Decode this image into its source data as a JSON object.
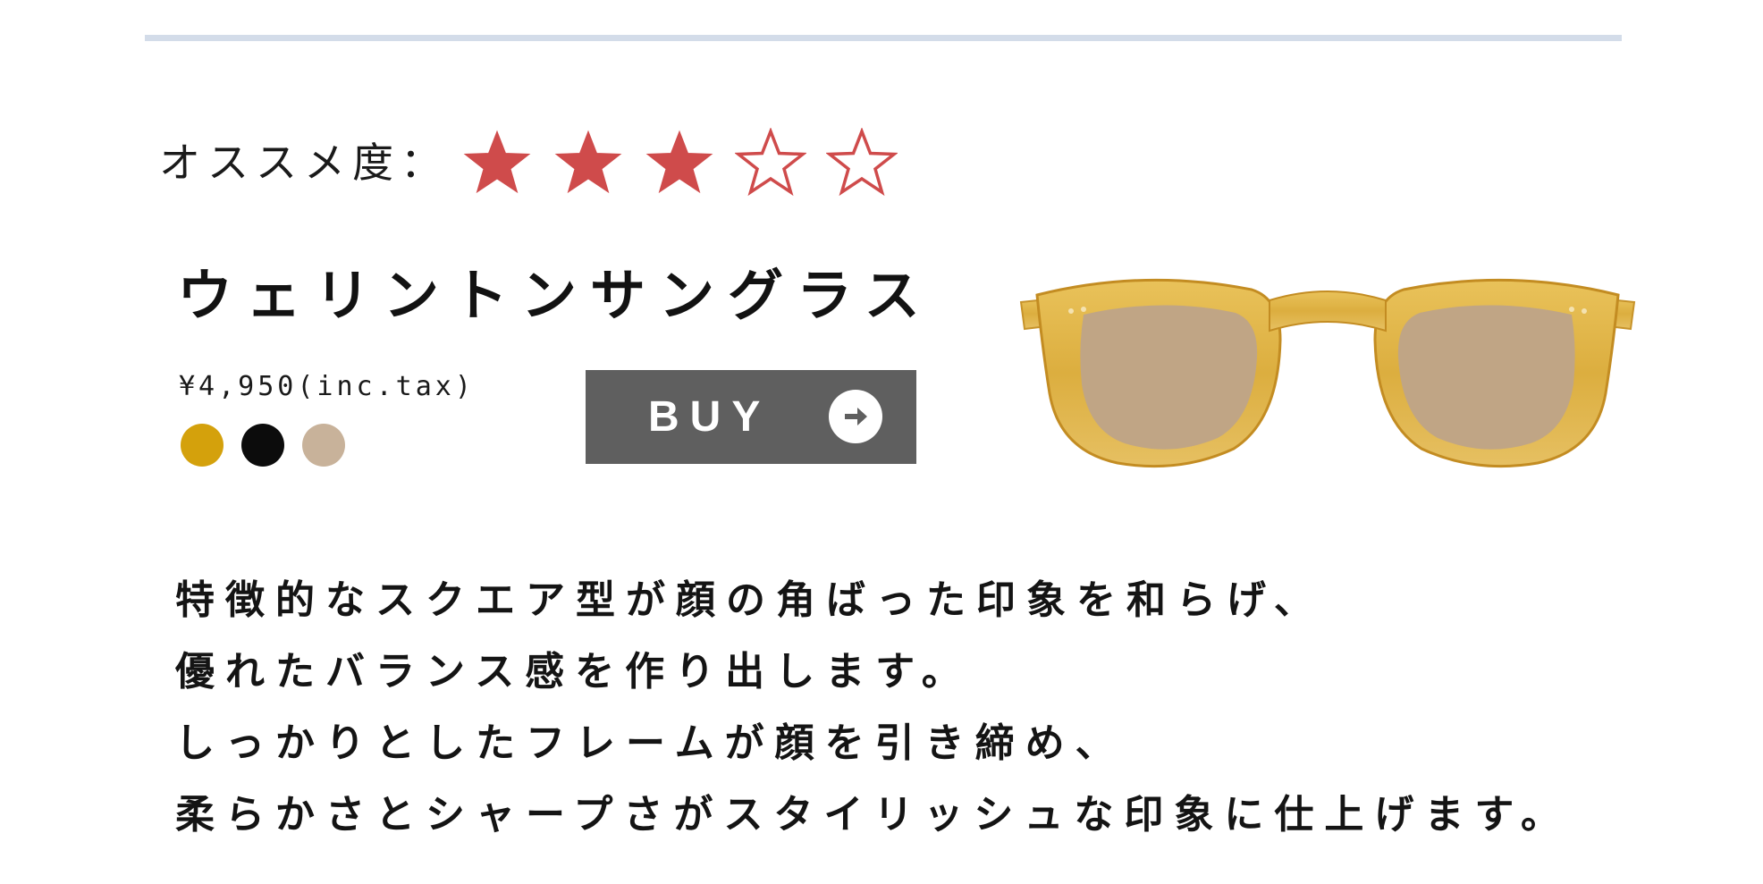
{
  "rating": {
    "label": "オススメ度：",
    "value": 3,
    "max": 5,
    "star_color": "#cf4b4b"
  },
  "product": {
    "name": "ウェリントンサングラス",
    "price": "¥4,950(inc.tax)",
    "colors": [
      "#d4a10c",
      "#0c0c0c",
      "#c8b29a"
    ],
    "buy_label": "BUY",
    "buy_icon": "arrow-right-circle-icon",
    "image": "sunglasses-image"
  },
  "description": {
    "lines": [
      "特徴的なスクエア型が顔の角ばった印象を和らげ、",
      "優れたバランス感を作り出します。",
      "しっかりとしたフレームが顔を引き締め、",
      "柔らかさとシャープさがスタイリッシュな印象に仕上げます。"
    ]
  }
}
